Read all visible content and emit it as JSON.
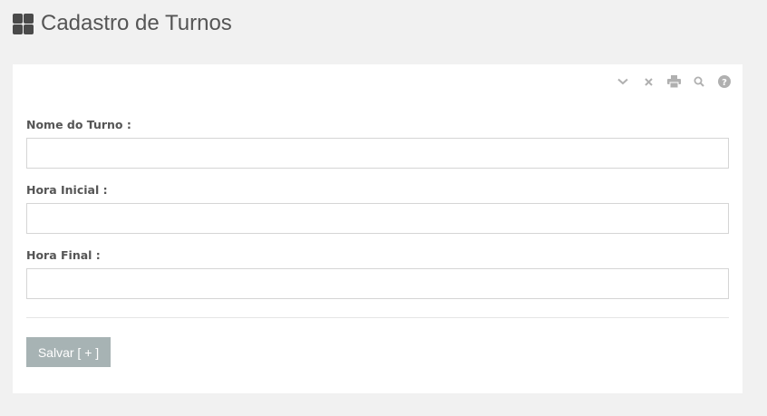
{
  "header": {
    "title": "Cadastro de Turnos",
    "icon": "grid-icon"
  },
  "toolbar": {
    "icons": [
      "chevron-down-icon",
      "close-icon",
      "print-icon",
      "search-icon",
      "help-icon"
    ],
    "icon_color": "#b0b0b0"
  },
  "form": {
    "fields": [
      {
        "label": "Nome do Turno :",
        "value": "",
        "placeholder": ""
      },
      {
        "label": "Hora Inicial :",
        "value": "",
        "placeholder": ""
      },
      {
        "label": "Hora Final :",
        "value": "",
        "placeholder": ""
      }
    ],
    "submit_label": "Salvar [ + ]"
  },
  "colors": {
    "background": "#f1f1f1",
    "panel": "#ffffff",
    "button": "#a7b3b4",
    "title": "#555555"
  }
}
